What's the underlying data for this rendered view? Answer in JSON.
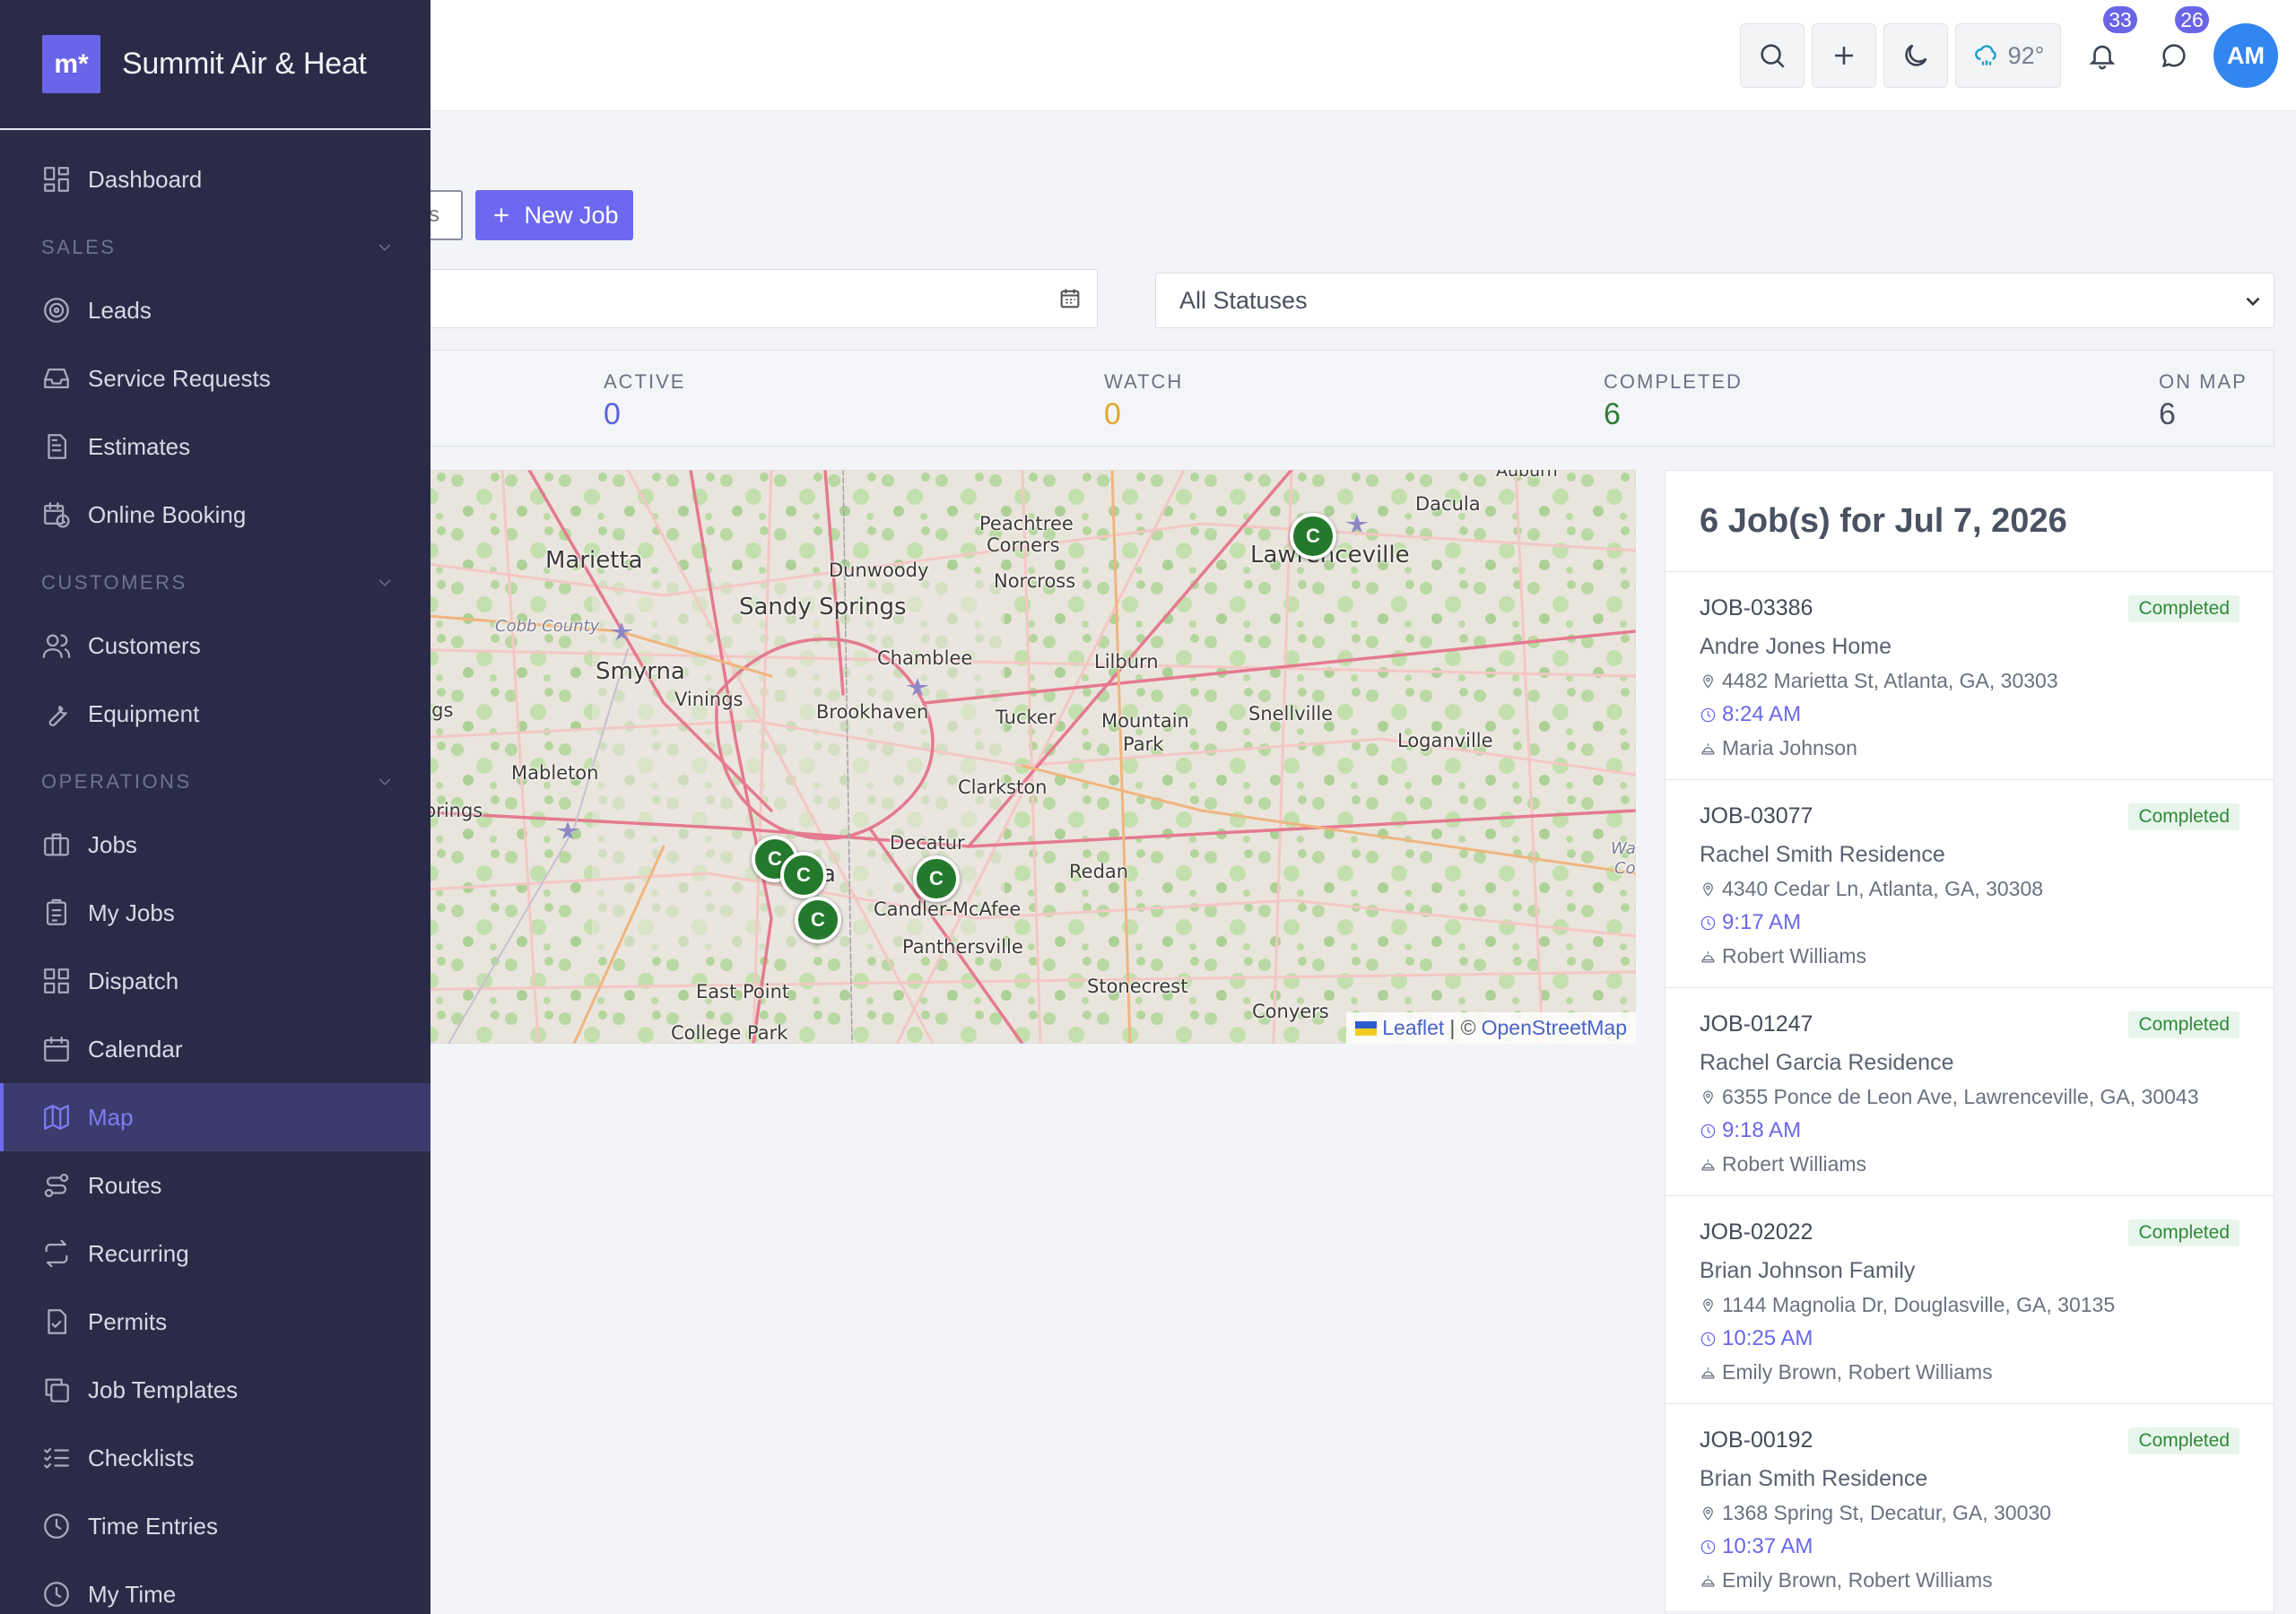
{
  "brand": {
    "logo_text": "m*",
    "name": "Summit Air & Heat"
  },
  "sidebar": {
    "items": [
      {
        "label": "Dashboard",
        "icon": "dashboard-icon"
      },
      {
        "section": "SALES"
      },
      {
        "label": "Leads",
        "icon": "target-icon"
      },
      {
        "label": "Service Requests",
        "icon": "inbox-icon"
      },
      {
        "label": "Estimates",
        "icon": "document-icon"
      },
      {
        "label": "Online Booking",
        "icon": "calendar-clock-icon"
      },
      {
        "section": "CUSTOMERS"
      },
      {
        "label": "Customers",
        "icon": "users-icon"
      },
      {
        "label": "Equipment",
        "icon": "wrench-icon"
      },
      {
        "section": "OPERATIONS"
      },
      {
        "label": "Jobs",
        "icon": "briefcase-icon"
      },
      {
        "label": "My Jobs",
        "icon": "clipboard-icon"
      },
      {
        "label": "Dispatch",
        "icon": "grid-icon"
      },
      {
        "label": "Calendar",
        "icon": "calendar-icon"
      },
      {
        "label": "Map",
        "icon": "map-icon",
        "active": true
      },
      {
        "label": "Routes",
        "icon": "route-icon"
      },
      {
        "label": "Recurring",
        "icon": "repeat-icon"
      },
      {
        "label": "Permits",
        "icon": "file-check-icon"
      },
      {
        "label": "Job Templates",
        "icon": "copy-icon"
      },
      {
        "label": "Checklists",
        "icon": "checklist-icon"
      },
      {
        "label": "Time Entries",
        "icon": "clock-icon"
      },
      {
        "label": "My Time",
        "icon": "clock-icon"
      }
    ]
  },
  "topbar": {
    "weather_temp": "92°",
    "notifications_count": "33",
    "messages_count": "26",
    "avatar_initials": "AM"
  },
  "toolbar": {
    "filter_button_fragment": "s",
    "new_job_label": "New Job",
    "date_value": "",
    "status_select": {
      "selected": "All Statuses"
    }
  },
  "stats": {
    "active_label": "ACTIVE",
    "active_value": "0",
    "watch_label": "WATCH",
    "watch_value": "0",
    "completed_label": "COMPLETED",
    "completed_value": "6",
    "onmap_label": "ON MAP",
    "onmap_value": "6"
  },
  "map": {
    "attribution_leaflet": "Leaflet",
    "attribution_sep": "| ©",
    "attribution_osm": "OpenStreetMap",
    "marker_label": "C",
    "places": {
      "auburn": "Auburn",
      "dacula": "Dacula",
      "marietta": "Marietta",
      "peachtree": "Peachtree",
      "corners": "Corners",
      "dunwoody": "Dunwoody",
      "lawrenceville": "Lawrenceville",
      "norcross": "Norcross",
      "sandy_springs": "Sandy Springs",
      "cobb_county": "Cobb County",
      "smyrna": "Smyrna",
      "chamblee": "Chamblee",
      "lilburn": "Lilburn",
      "vinings": "Vinings",
      "springs": "prings",
      "brookhaven": "Brookhaven",
      "tucker": "Tucker",
      "mountain": "Mountain",
      "park": "Park",
      "snellville": "Snellville",
      "loganville": "Loganville",
      "mableton": "Mableton",
      "clarkston": "Clarkston",
      "a_springs": "a Springs",
      "decatur": "Decatur",
      "redan": "Redan",
      "atlanta": "a",
      "candler": "Candler-McAfee",
      "panthersville": "Panthersville",
      "stonecrest": "Stonecrest",
      "east_point": "East Point",
      "college_park": "College Park",
      "conyers": "Conyers",
      "wa": "Wa",
      "co": "Co"
    }
  },
  "jobs_panel": {
    "title": "6 Job(s) for Jul 7, 2026",
    "jobs": [
      {
        "id": "JOB-03386",
        "status": "Completed",
        "name": "Andre Jones Home",
        "address": "4482 Marietta St, Atlanta, GA, 30303",
        "time": "8:24 AM",
        "techs": "Maria Johnson"
      },
      {
        "id": "JOB-03077",
        "status": "Completed",
        "name": "Rachel Smith Residence",
        "address": "4340 Cedar Ln, Atlanta, GA, 30308",
        "time": "9:17 AM",
        "techs": "Robert Williams"
      },
      {
        "id": "JOB-01247",
        "status": "Completed",
        "name": "Rachel Garcia Residence",
        "address": "6355 Ponce de Leon Ave, Lawrenceville, GA, 30043",
        "time": "9:18 AM",
        "techs": "Robert Williams"
      },
      {
        "id": "JOB-02022",
        "status": "Completed",
        "name": "Brian Johnson Family",
        "address": "1144 Magnolia Dr, Douglasville, GA, 30135",
        "time": "10:25 AM",
        "techs": "Emily Brown, Robert Williams"
      },
      {
        "id": "JOB-00192",
        "status": "Completed",
        "name": "Brian Smith Residence",
        "address": "1368 Spring St, Decatur, GA, 30030",
        "time": "10:37 AM",
        "techs": "Emily Brown, Robert Williams"
      }
    ]
  },
  "colors": {
    "accent": "#6d68f0",
    "sidebar_bg": "#2a2b47",
    "active_value": "#5b63d8",
    "watch_value": "#e0a82e",
    "completed_value": "#2f7d34",
    "marker": "#247a2c"
  }
}
